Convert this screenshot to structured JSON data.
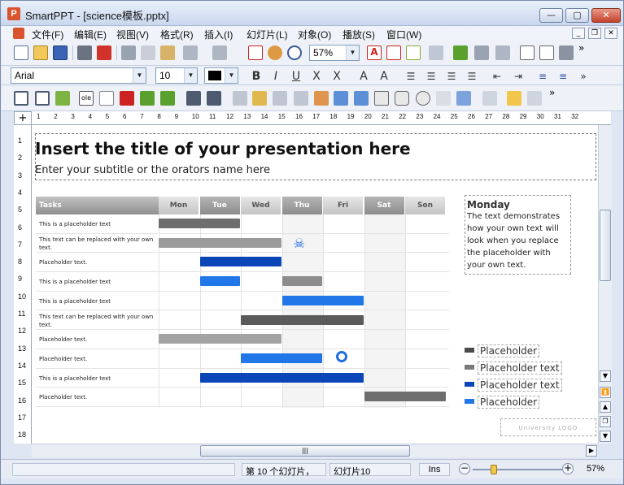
{
  "window": {
    "title": "SmartPPT - [science模板.pptx]",
    "app_icon": "P"
  },
  "menubar": {
    "items": [
      "文件(F)",
      "编辑(E)",
      "视图(V)",
      "格式(R)",
      "插入(I)",
      "幻灯片(L)",
      "对象(O)",
      "播放(S)",
      "窗口(W)"
    ]
  },
  "toolbar": {
    "zoom": "57%",
    "font_name": "Arial",
    "font_size": "10"
  },
  "ruler": {
    "h_ticks": [
      "1",
      "2",
      "3",
      "4",
      "5",
      "6",
      "7",
      "8",
      "9",
      "10",
      "11",
      "12",
      "13",
      "14",
      "15",
      "16",
      "17",
      "18",
      "19",
      "20",
      "21",
      "22",
      "23",
      "24",
      "25",
      "26",
      "27",
      "28",
      "29",
      "30",
      "31",
      "32"
    ],
    "v_ticks": [
      "1",
      "2",
      "3",
      "4",
      "5",
      "6",
      "7",
      "8",
      "9",
      "10",
      "11",
      "12",
      "13",
      "14",
      "15",
      "16",
      "17",
      "18"
    ]
  },
  "slide": {
    "title": "Insert the title of your presentation here",
    "subtitle": "Enter your subtitle or the orators name here",
    "gantt": {
      "tasks_header": "Tasks",
      "days": [
        "Mon",
        "Tue",
        "Wed",
        "Thu",
        "Fri",
        "Sat",
        "Son"
      ],
      "rows": [
        "This is a placeholder text",
        "This text can be replaced with your own text.",
        "Placeholder text.",
        "This is a placeholder text",
        "This is a placeholder text",
        "This text can be replaced with your own text.",
        "Placeholder text.",
        "Placeholder text.",
        "This is a placeholder text",
        "Placeholder text."
      ],
      "bars": [
        {
          "row": 0,
          "start": 0,
          "end": 2,
          "color": "#6e6e6e"
        },
        {
          "row": 1,
          "start": 0,
          "end": 3,
          "color": "#9a9a9a"
        },
        {
          "row": 2,
          "start": 1,
          "end": 3,
          "color": "#0b46b8"
        },
        {
          "row": 3,
          "start": 1,
          "end": 2,
          "color": "#2176e8"
        },
        {
          "row": 3,
          "start": 3,
          "end": 4,
          "color": "#8c8c8c"
        },
        {
          "row": 4,
          "start": 3,
          "end": 5,
          "color": "#2176e8"
        },
        {
          "row": 5,
          "start": 2,
          "end": 5,
          "color": "#5b5b5b"
        },
        {
          "row": 6,
          "start": 0,
          "end": 3,
          "color": "#a3a3a3"
        },
        {
          "row": 7,
          "start": 2,
          "end": 4,
          "color": "#2176e8"
        },
        {
          "row": 8,
          "start": 1,
          "end": 5,
          "color": "#0b46b8"
        },
        {
          "row": 9,
          "start": 5,
          "end": 7,
          "color": "#6e6e6e"
        }
      ]
    },
    "monday": {
      "title": "Monday",
      "text": "The text demonstrates how your own text will look when you replace the placeholder with your own text."
    },
    "legend": [
      {
        "label": "Placeholder",
        "color": "#4a4a4a"
      },
      {
        "label": "Placeholder text",
        "color": "#7a7a7a"
      },
      {
        "label": "Placeholder text",
        "color": "#0b46b8"
      },
      {
        "label": "Placeholder",
        "color": "#2176e8"
      }
    ],
    "logo_text": "University LOGO"
  },
  "statusbar": {
    "slide_info": "第 10 个幻灯片，",
    "slide_name": "幻灯片10",
    "mode": "Ins",
    "zoom": "57%"
  }
}
